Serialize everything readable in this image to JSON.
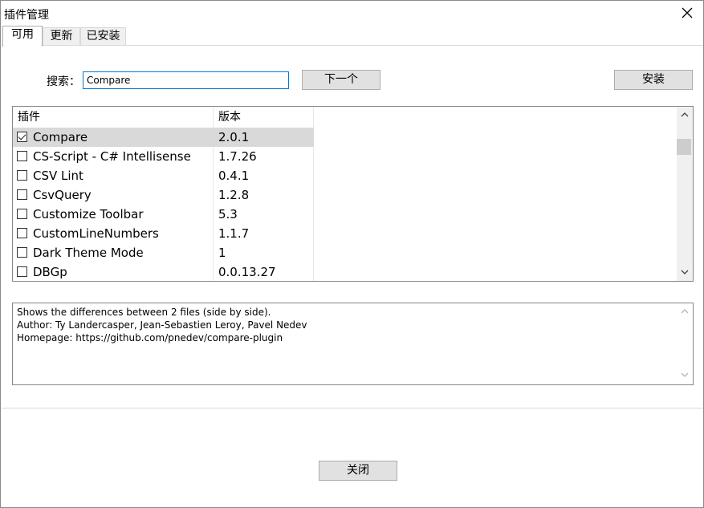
{
  "window": {
    "title": "插件管理"
  },
  "tabs": [
    {
      "label": "可用"
    },
    {
      "label": "更新"
    },
    {
      "label": "已安装"
    }
  ],
  "search": {
    "label": "搜索：",
    "value": "Compare"
  },
  "buttons": {
    "next": "下一个",
    "install": "安装",
    "close": "关闭"
  },
  "list": {
    "columns": [
      "插件",
      "版本"
    ],
    "rows": [
      {
        "name": "Compare",
        "version": "2.0.1",
        "checked": true,
        "selected": true
      },
      {
        "name": "CS-Script - C# Intellisense",
        "version": "1.7.26",
        "checked": false
      },
      {
        "name": "CSV Lint",
        "version": "0.4.1",
        "checked": false
      },
      {
        "name": "CsvQuery",
        "version": "1.2.8",
        "checked": false
      },
      {
        "name": "Customize Toolbar",
        "version": "5.3",
        "checked": false
      },
      {
        "name": "CustomLineNumbers",
        "version": "1.1.7",
        "checked": false
      },
      {
        "name": "Dark Theme Mode",
        "version": "1",
        "checked": false
      },
      {
        "name": "DBGp",
        "version": "0.0.13.27",
        "checked": false
      }
    ]
  },
  "description": {
    "lines": [
      "Shows the differences between 2 files (side by side).",
      "Author: Ty Landercasper, Jean-Sebastien Leroy, Pavel Nedev",
      "Homepage: https://github.com/pnedev/compare-plugin"
    ]
  },
  "icons": {
    "close": "close-icon",
    "scroll_up": "chevron-up-icon",
    "scroll_down": "chevron-down-icon",
    "check": "checkmark-icon"
  }
}
